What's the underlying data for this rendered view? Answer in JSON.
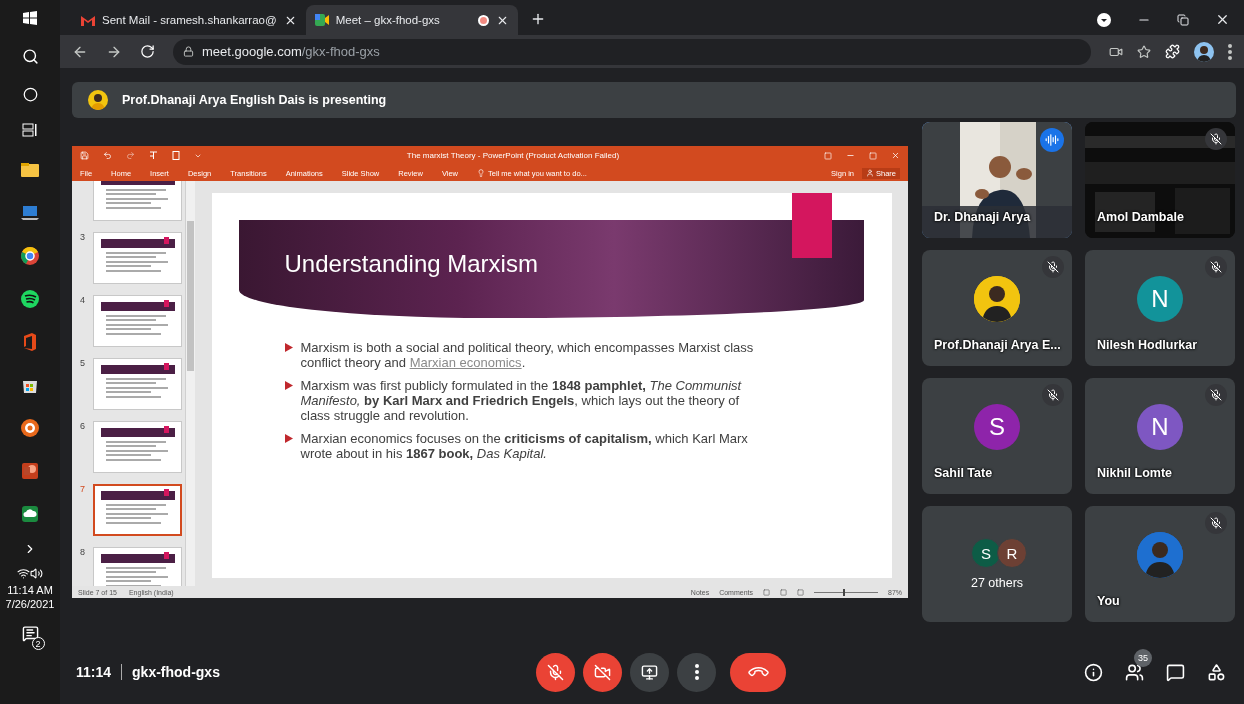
{
  "taskbar": {
    "time": "11:14 AM",
    "date": "7/26/2021",
    "notifications": "2"
  },
  "browser": {
    "tabs": [
      {
        "kind": "gmail",
        "title": "Sent Mail - sramesh.shankarrao@",
        "selected": false,
        "recording": false
      },
      {
        "kind": "meet",
        "title": "Meet – gkx-fhod-gxs",
        "selected": true,
        "recording": true
      }
    ],
    "address": {
      "host": "meet.google.com",
      "path": "/gkx-fhod-gxs"
    }
  },
  "banner": {
    "text": "Prof.Dhanaji Arya English Dais is presenting"
  },
  "powerpoint": {
    "title": "The marxist Theory - PowerPoint (Product Activation Failed)",
    "menu": [
      {
        "label": "File",
        "selected": false
      },
      {
        "label": "Home",
        "selected": false
      },
      {
        "label": "Insert",
        "selected": false
      },
      {
        "label": "Design",
        "selected": false
      },
      {
        "label": "Transitions",
        "selected": false
      },
      {
        "label": "Animations",
        "selected": false
      },
      {
        "label": "Slide Show",
        "selected": false
      },
      {
        "label": "Review",
        "selected": false
      },
      {
        "label": "View",
        "selected": false
      }
    ],
    "tell_me": "Tell me what you want to do...",
    "sign_in": "Sign in",
    "share": "Share",
    "thumbnails": [
      {
        "selected": false
      },
      {
        "number": "3",
        "selected": false
      },
      {
        "number": "4",
        "selected": false
      },
      {
        "number": "5",
        "selected": false
      },
      {
        "number": "6",
        "selected": false
      },
      {
        "number": "7",
        "selected": true
      },
      {
        "number": "8",
        "selected": false
      }
    ],
    "slide": {
      "title": "Understanding Marxism",
      "bullets": [
        {
          "text": "Marxism is both a social and political theory, which encompasses Marxist class conflict theory and ",
          "link": "Marxian economics",
          "after": "."
        },
        {
          "text": "Marxism was first publicly formulated in the **1848 pamphlet,** *The Communist Manifesto,* **by Karl Marx and Friedrich Engels**, which lays out the theory of class struggle and revolution."
        },
        {
          "text": "Marxian economics focuses on the **criticisms of capitalism,** which Karl Marx wrote about in his **1867 book,** *Das Kapital.*"
        }
      ]
    },
    "status": {
      "slide": "Slide 7 of 15",
      "language": "English (India)",
      "notes": "Notes",
      "comments": "Comments",
      "zoom": {
        "level": 0.45,
        "reading": "87%"
      }
    }
  },
  "participants": [
    {
      "kind": "video",
      "name": "Dr. Dhanaji Arya",
      "speaking": true,
      "muted": false
    },
    {
      "kind": "video",
      "name": "Amol Dambale",
      "speaking": false,
      "muted": true
    },
    {
      "kind": "avatar",
      "name": "Prof.Dhanaji Arya E...",
      "speaking": false,
      "muted": true
    },
    {
      "kind": "avatar",
      "name": "Nilesh Hodlurkar",
      "speaking": false,
      "muted": true,
      "avatar": {
        "kind": "letter",
        "letter": "N",
        "color": "#12939a"
      }
    },
    {
      "kind": "avatar",
      "name": "Sahil Tate",
      "speaking": false,
      "muted": true,
      "avatar": {
        "kind": "letter",
        "letter": "S",
        "color": "#8e24aa"
      }
    },
    {
      "kind": "avatar",
      "name": "Nikhil Lomte",
      "speaking": false,
      "muted": true,
      "avatar": {
        "kind": "letter",
        "letter": "N",
        "color": "#7e57c2"
      }
    },
    {
      "kind": "others",
      "label": "27 others",
      "avatars": [
        {
          "letter": "S",
          "color": "#0d5c46"
        },
        {
          "letter": "R",
          "color": "#6d4034"
        }
      ]
    },
    {
      "kind": "avatar",
      "name": "You",
      "speaking": false,
      "muted": true
    }
  ],
  "meeting": {
    "time": "11:14",
    "code": "gkx-fhod-gxs",
    "mic_on": false,
    "camera_on": false,
    "people_count": "35"
  }
}
